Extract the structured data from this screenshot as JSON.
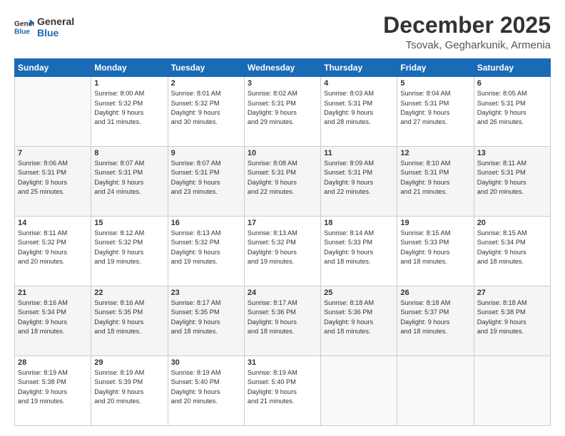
{
  "header": {
    "logo_line1": "General",
    "logo_line2": "Blue",
    "month": "December 2025",
    "location": "Tsovak, Gegharkunik, Armenia"
  },
  "weekdays": [
    "Sunday",
    "Monday",
    "Tuesday",
    "Wednesday",
    "Thursday",
    "Friday",
    "Saturday"
  ],
  "weeks": [
    [
      {
        "day": "",
        "info": ""
      },
      {
        "day": "1",
        "info": "Sunrise: 8:00 AM\nSunset: 5:32 PM\nDaylight: 9 hours\nand 31 minutes."
      },
      {
        "day": "2",
        "info": "Sunrise: 8:01 AM\nSunset: 5:32 PM\nDaylight: 9 hours\nand 30 minutes."
      },
      {
        "day": "3",
        "info": "Sunrise: 8:02 AM\nSunset: 5:31 PM\nDaylight: 9 hours\nand 29 minutes."
      },
      {
        "day": "4",
        "info": "Sunrise: 8:03 AM\nSunset: 5:31 PM\nDaylight: 9 hours\nand 28 minutes."
      },
      {
        "day": "5",
        "info": "Sunrise: 8:04 AM\nSunset: 5:31 PM\nDaylight: 9 hours\nand 27 minutes."
      },
      {
        "day": "6",
        "info": "Sunrise: 8:05 AM\nSunset: 5:31 PM\nDaylight: 9 hours\nand 26 minutes."
      }
    ],
    [
      {
        "day": "7",
        "info": "Sunrise: 8:06 AM\nSunset: 5:31 PM\nDaylight: 9 hours\nand 25 minutes."
      },
      {
        "day": "8",
        "info": "Sunrise: 8:07 AM\nSunset: 5:31 PM\nDaylight: 9 hours\nand 24 minutes."
      },
      {
        "day": "9",
        "info": "Sunrise: 8:07 AM\nSunset: 5:31 PM\nDaylight: 9 hours\nand 23 minutes."
      },
      {
        "day": "10",
        "info": "Sunrise: 8:08 AM\nSunset: 5:31 PM\nDaylight: 9 hours\nand 22 minutes."
      },
      {
        "day": "11",
        "info": "Sunrise: 8:09 AM\nSunset: 5:31 PM\nDaylight: 9 hours\nand 22 minutes."
      },
      {
        "day": "12",
        "info": "Sunrise: 8:10 AM\nSunset: 5:31 PM\nDaylight: 9 hours\nand 21 minutes."
      },
      {
        "day": "13",
        "info": "Sunrise: 8:11 AM\nSunset: 5:31 PM\nDaylight: 9 hours\nand 20 minutes."
      }
    ],
    [
      {
        "day": "14",
        "info": "Sunrise: 8:11 AM\nSunset: 5:32 PM\nDaylight: 9 hours\nand 20 minutes."
      },
      {
        "day": "15",
        "info": "Sunrise: 8:12 AM\nSunset: 5:32 PM\nDaylight: 9 hours\nand 19 minutes."
      },
      {
        "day": "16",
        "info": "Sunrise: 8:13 AM\nSunset: 5:32 PM\nDaylight: 9 hours\nand 19 minutes."
      },
      {
        "day": "17",
        "info": "Sunrise: 8:13 AM\nSunset: 5:32 PM\nDaylight: 9 hours\nand 19 minutes."
      },
      {
        "day": "18",
        "info": "Sunrise: 8:14 AM\nSunset: 5:33 PM\nDaylight: 9 hours\nand 18 minutes."
      },
      {
        "day": "19",
        "info": "Sunrise: 8:15 AM\nSunset: 5:33 PM\nDaylight: 9 hours\nand 18 minutes."
      },
      {
        "day": "20",
        "info": "Sunrise: 8:15 AM\nSunset: 5:34 PM\nDaylight: 9 hours\nand 18 minutes."
      }
    ],
    [
      {
        "day": "21",
        "info": "Sunrise: 8:16 AM\nSunset: 5:34 PM\nDaylight: 9 hours\nand 18 minutes."
      },
      {
        "day": "22",
        "info": "Sunrise: 8:16 AM\nSunset: 5:35 PM\nDaylight: 9 hours\nand 18 minutes."
      },
      {
        "day": "23",
        "info": "Sunrise: 8:17 AM\nSunset: 5:35 PM\nDaylight: 9 hours\nand 18 minutes."
      },
      {
        "day": "24",
        "info": "Sunrise: 8:17 AM\nSunset: 5:36 PM\nDaylight: 9 hours\nand 18 minutes."
      },
      {
        "day": "25",
        "info": "Sunrise: 8:18 AM\nSunset: 5:36 PM\nDaylight: 9 hours\nand 18 minutes."
      },
      {
        "day": "26",
        "info": "Sunrise: 8:18 AM\nSunset: 5:37 PM\nDaylight: 9 hours\nand 18 minutes."
      },
      {
        "day": "27",
        "info": "Sunrise: 8:18 AM\nSunset: 5:38 PM\nDaylight: 9 hours\nand 19 minutes."
      }
    ],
    [
      {
        "day": "28",
        "info": "Sunrise: 8:19 AM\nSunset: 5:38 PM\nDaylight: 9 hours\nand 19 minutes."
      },
      {
        "day": "29",
        "info": "Sunrise: 8:19 AM\nSunset: 5:39 PM\nDaylight: 9 hours\nand 20 minutes."
      },
      {
        "day": "30",
        "info": "Sunrise: 8:19 AM\nSunset: 5:40 PM\nDaylight: 9 hours\nand 20 minutes."
      },
      {
        "day": "31",
        "info": "Sunrise: 8:19 AM\nSunset: 5:40 PM\nDaylight: 9 hours\nand 21 minutes."
      },
      {
        "day": "",
        "info": ""
      },
      {
        "day": "",
        "info": ""
      },
      {
        "day": "",
        "info": ""
      }
    ]
  ]
}
